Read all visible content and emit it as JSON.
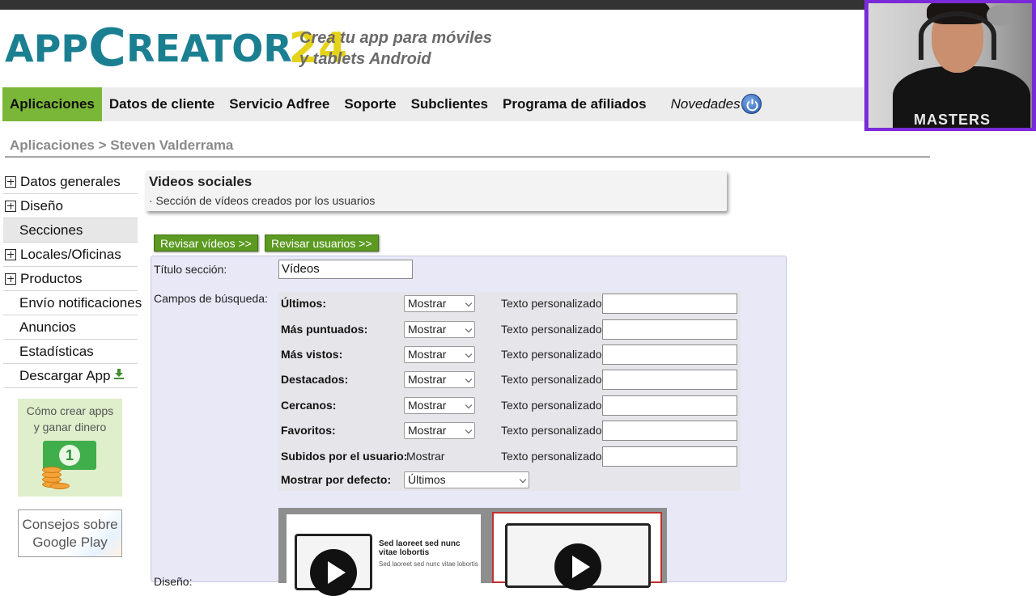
{
  "brand": {
    "logo_app": "APP",
    "logo_c": "C",
    "logo_reator": "REATOR",
    "logo_num": "24",
    "tagline_line1": "Crea tu app para móviles",
    "tagline_line2": "y tablets Android",
    "color_teal": "#1b7f92",
    "color_yellow": "#e5d21a"
  },
  "nav": {
    "items": [
      "Aplicaciones",
      "Datos de cliente",
      "Servicio Adfree",
      "Soporte",
      "Subclientes",
      "Programa de afiliados",
      "Novedades"
    ],
    "active": "Aplicaciones",
    "power_icon": "power-icon",
    "accent": "#7ab738"
  },
  "breadcrumb": "Aplicaciones > Steven Valderrama",
  "sidebar": {
    "items": [
      {
        "label": "Datos generales",
        "expandable": true
      },
      {
        "label": "Diseño",
        "expandable": true
      },
      {
        "label": "Secciones",
        "expandable": false
      },
      {
        "label": "Locales/Oficinas",
        "expandable": true
      },
      {
        "label": "Productos",
        "expandable": true
      },
      {
        "label": "Envío notificaciones",
        "expandable": false
      },
      {
        "label": "Anuncios",
        "expandable": false
      },
      {
        "label": "Estadísticas",
        "expandable": false
      },
      {
        "label": "Descargar App",
        "expandable": false
      }
    ],
    "promo1_line1": "Cómo crear apps",
    "promo1_line2": "y ganar dinero",
    "promo1_bill": "1",
    "promo2_line1": "Consejos sobre",
    "promo2_line2": "Google Play"
  },
  "section": {
    "title": "Videos sociales",
    "subtitle": "· Sección de vídeos creados por los usuarios",
    "btn_review_videos": "Revisar vídeos >>",
    "btn_review_users": "Revisar usuarios >>"
  },
  "form": {
    "title_label": "Título sección:",
    "title_value": "Vídeos",
    "search_fields_label": "Campos de búsqueda:",
    "custom_text_label": "Texto personalizado:",
    "rows": [
      {
        "label": "Últimos:",
        "value": "Mostrar"
      },
      {
        "label": "Más puntuados:",
        "value": "Mostrar"
      },
      {
        "label": "Más vistos:",
        "value": "Mostrar"
      },
      {
        "label": "Destacados:",
        "value": "Mostrar"
      },
      {
        "label": "Cercanos:",
        "value": "Mostrar"
      },
      {
        "label": "Favoritos:",
        "value": "Mostrar"
      }
    ],
    "uploaded_label": "Subidos por el usuario:",
    "uploaded_value": "Mostrar",
    "default_label": "Mostrar por defecto:",
    "default_value": "Últimos",
    "design_label": "Diseño:",
    "preview_title": "Sed laoreet sed nunc vitae lobortis",
    "preview_sub": "Sed laoreet sed nunc vitae lobortis"
  },
  "webcam": {
    "shirt_text": "MASTERS",
    "border_color": "#7b2ad9"
  }
}
